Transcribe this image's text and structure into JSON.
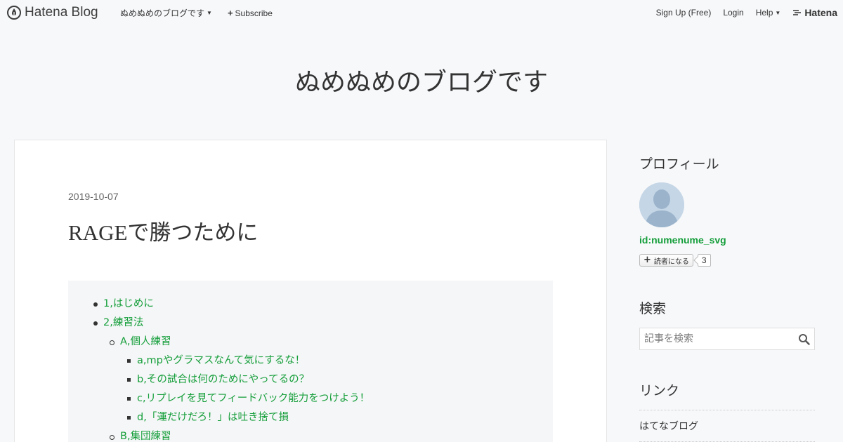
{
  "topbar": {
    "logo_text": "Hatena Blog",
    "blog_menu_label": "ぬめぬめのブログです",
    "subscribe_label": "Subscribe",
    "signup_label": "Sign Up (Free)",
    "login_label": "Login",
    "help_label": "Help",
    "hatena_label": "Hatena"
  },
  "blog": {
    "title": "ぬめぬめのブログです"
  },
  "entry": {
    "date": "2019-10-07",
    "title": "RAGEで勝つために",
    "toc": [
      {
        "level": 1,
        "text": "1,はじめに"
      },
      {
        "level": 1,
        "text": "2,練習法"
      },
      {
        "level": 2,
        "text": "A,個人練習"
      },
      {
        "level": 3,
        "text": "a,mpやグラマスなんて気にするな！"
      },
      {
        "level": 3,
        "text": "b,その試合は何のためにやってるの？"
      },
      {
        "level": 3,
        "text": "c,リプレイを見てフィードバック能力をつけよう！"
      },
      {
        "level": 3,
        "text": "d,「運だけだろ！」は吐き捨て損"
      },
      {
        "level": 2,
        "text": "B,集団練習"
      }
    ]
  },
  "sidebar": {
    "profile_heading": "プロフィール",
    "profile_id": "id:numenume_svg",
    "reader_button_label": "読者になる",
    "reader_count": "3",
    "search_heading": "検索",
    "search_placeholder": "記事を検索",
    "links_heading": "リンク",
    "links": [
      {
        "label": "はてなブログ"
      }
    ]
  },
  "colors": {
    "link_green": "#149e3a",
    "background": "#f7f8fa",
    "card": "#ffffff",
    "toc_background": "#f5f6f7"
  },
  "icons": {
    "logo": "hatena-blog-pen-icon",
    "subscribe": "plus-icon",
    "search": "search-icon",
    "avatar": "user-avatar-icon"
  }
}
